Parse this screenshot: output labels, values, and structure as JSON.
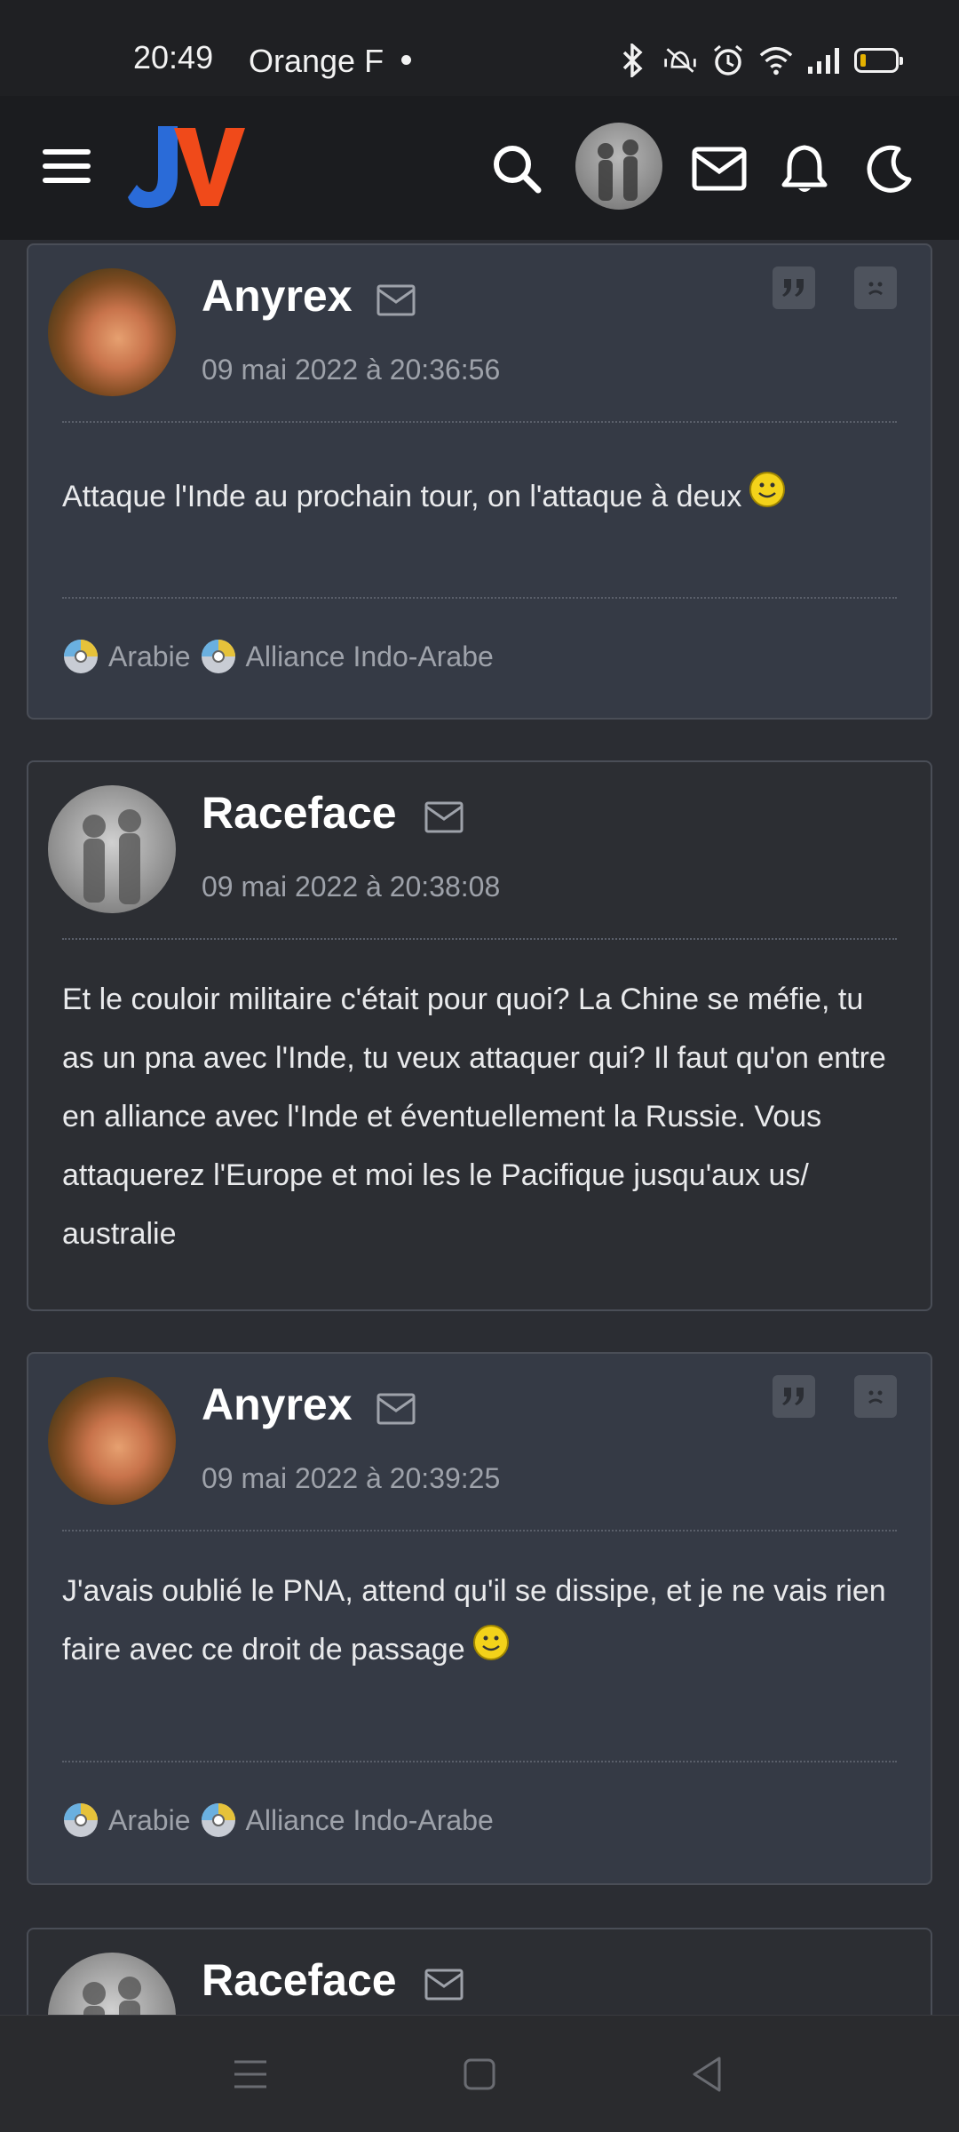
{
  "status_bar": {
    "time": "20:49",
    "carrier": "Orange F",
    "icons": [
      "bluetooth-icon",
      "vibrate-off-icon",
      "alarm-icon",
      "wifi-icon",
      "signal-icon",
      "battery-icon"
    ]
  },
  "header": {
    "logo_text": "JV",
    "logo_colors": {
      "j": "#2a6bd8",
      "v": "#f04a1a"
    },
    "icons": [
      "menu-icon",
      "search-icon",
      "avatar",
      "mail-icon",
      "bell-icon",
      "dark-mode-icon"
    ]
  },
  "posts": [
    {
      "author": "Anyrex",
      "date": "09 mai 2022 à 20:36:56",
      "message": "Attaque l'Inde au prochain tour, on l'attaque à deux",
      "has_smiley": true,
      "signature": [
        "Arabie",
        "Alliance Indo-Arabe"
      ]
    },
    {
      "author": "Raceface",
      "date": "09 mai 2022 à 20:38:08",
      "message": "Et le couloir militaire c'était pour quoi? La Chine se méfie, tu as un pna avec l'Inde, tu veux attaquer qui? Il faut qu'on entre en alliance avec l'Inde et éventuellement la Russie. Vous attaquerez l'Europe et moi les le Pacifique jusqu'aux us/ australie"
    },
    {
      "author": "Anyrex",
      "date": "09 mai 2022 à 20:39:25",
      "message": "J'avais oublié le PNA, attend qu'il se dissipe, et je ne vais rien faire avec ce droit de passage",
      "has_smiley": true,
      "signature": [
        "Arabie",
        "Alliance Indo-Arabe"
      ]
    },
    {
      "author": "Raceface"
    }
  ],
  "nav_bar": {
    "icons": [
      "recents-icon",
      "home-icon",
      "back-icon"
    ]
  },
  "colors": {
    "accent_blue": "#2a6bd8",
    "accent_orange": "#f04a1a",
    "card_light": "#353a45",
    "card_dark": "#2c2e33"
  }
}
